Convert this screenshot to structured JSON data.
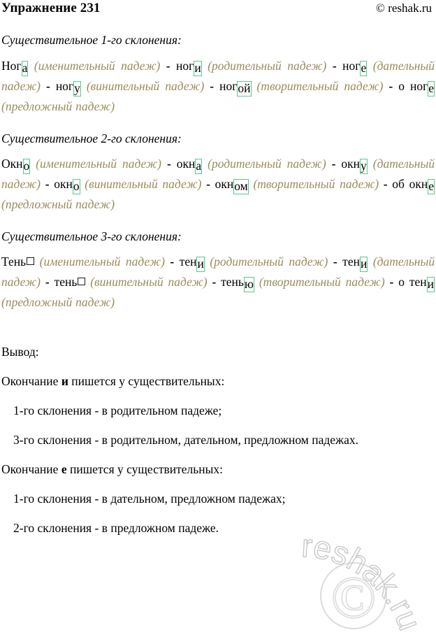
{
  "header": {
    "title": "Упражнение 231",
    "copyright": "© reshak.ru"
  },
  "watermark": {
    "text": "reshak.ru",
    "symbol": "©"
  },
  "cases": {
    "nominative": "(именительный падеж)",
    "genitive": "(родительный падеж)",
    "dative": "(дательный падеж)",
    "accusative": "(винительный падеж)",
    "instrumental": "(творительный падеж)",
    "prepositional": "(предложный падеж)"
  },
  "separator": "-",
  "sections": [
    {
      "heading": "Существительное 1-го склонения:",
      "forms": [
        {
          "stem": "Ног",
          "ending": "а",
          "zero": false,
          "prefix": ""
        },
        {
          "stem": "ног",
          "ending": "и",
          "zero": false,
          "prefix": ""
        },
        {
          "stem": "ног",
          "ending": "е",
          "zero": false,
          "prefix": ""
        },
        {
          "stem": "ног",
          "ending": "у",
          "zero": false,
          "prefix": ""
        },
        {
          "stem": "ног",
          "ending": "ой",
          "zero": false,
          "prefix": ""
        },
        {
          "stem": "ног",
          "ending": "е",
          "zero": false,
          "prefix": "о "
        }
      ]
    },
    {
      "heading": "Существительное 2-го склонения:",
      "forms": [
        {
          "stem": "Окн",
          "ending": "о",
          "zero": false,
          "prefix": ""
        },
        {
          "stem": "окн",
          "ending": "а",
          "zero": false,
          "prefix": ""
        },
        {
          "stem": "окн",
          "ending": "у",
          "zero": false,
          "prefix": ""
        },
        {
          "stem": "окн",
          "ending": "о",
          "zero": false,
          "prefix": ""
        },
        {
          "stem": "окн",
          "ending": "ом",
          "zero": false,
          "prefix": ""
        },
        {
          "stem": "окн",
          "ending": "е",
          "zero": false,
          "prefix": "об "
        }
      ]
    },
    {
      "heading": "Существительное 3-го склонения:",
      "forms": [
        {
          "stem": "Тень",
          "ending": "",
          "zero": true,
          "prefix": ""
        },
        {
          "stem": "тен",
          "ending": "и",
          "zero": false,
          "prefix": ""
        },
        {
          "stem": "тен",
          "ending": "и",
          "zero": false,
          "prefix": ""
        },
        {
          "stem": "тень",
          "ending": "",
          "zero": true,
          "prefix": ""
        },
        {
          "stem": "тень",
          "ending": "ю",
          "zero": false,
          "prefix": ""
        },
        {
          "stem": "тен",
          "ending": "и",
          "zero": false,
          "prefix": "о "
        }
      ]
    }
  ],
  "conclusion": {
    "label": "Вывод:",
    "rules": [
      {
        "lead_before": "Окончание ",
        "letter": "и",
        "lead_after": " пишется у существительных:",
        "items": [
          "1-го склонения - в родительном падеже;",
          "3-го склонения - в родительном, дательном, предложном падежах."
        ]
      },
      {
        "lead_before": "Окончание ",
        "letter": "е",
        "lead_after": " пишется у существительных:",
        "items": [
          "1-го склонения - в дательном, предложном падежах;",
          "2-го склонения - в предложном падеже."
        ]
      }
    ]
  },
  "colors": {
    "ending_box": "#57c98a",
    "case_text": "#9b8c5a",
    "text": "#000000",
    "watermark": "#d8d8d8"
  }
}
